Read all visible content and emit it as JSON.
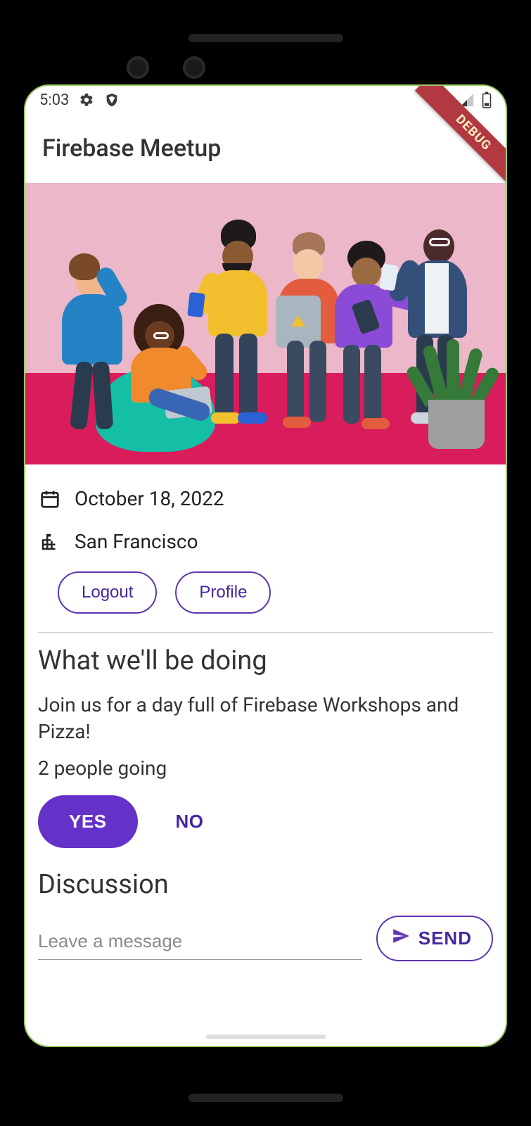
{
  "status": {
    "time": "5:03",
    "debug_label": "DEBUG"
  },
  "appbar": {
    "title": "Firebase Meetup"
  },
  "event": {
    "date": "October 18, 2022",
    "location": "San Francisco"
  },
  "auth_buttons": {
    "logout": "Logout",
    "profile": "Profile"
  },
  "about": {
    "heading": "What we'll be doing",
    "description": "Join us for a day full of Firebase Workshops and Pizza!",
    "going_text": "2 people going"
  },
  "rsvp": {
    "yes": "YES",
    "no": "NO"
  },
  "discussion": {
    "heading": "Discussion",
    "placeholder": "Leave a message",
    "send": "SEND"
  }
}
